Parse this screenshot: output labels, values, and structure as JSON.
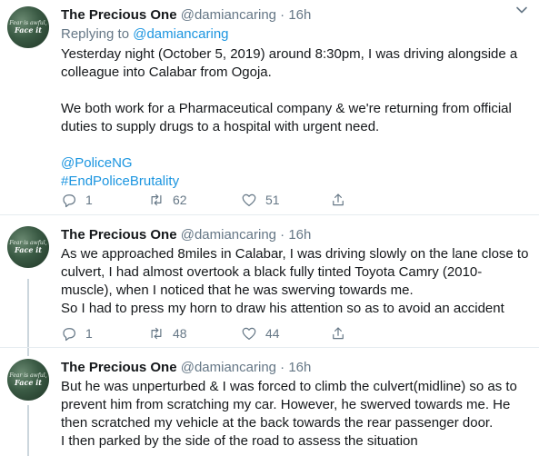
{
  "colors": {
    "text": "#14171a",
    "secondary": "#657786",
    "link": "#1b95e0",
    "divider": "#e6ecf0"
  },
  "tweets": [
    {
      "name": "The Precious One",
      "handle": "@damiancaring",
      "dot": "·",
      "time": "16h",
      "avatar_line1": "Fear is awful,",
      "avatar_line2": "Face it",
      "replying_prefix": "Replying to",
      "replying_handle": "@damiancaring",
      "paragraphs": [
        "Yesterday night (October 5, 2019) around 8:30pm, I was driving alongside a colleague into Calabar from Ogoja.",
        "We both work for a Pharmaceutical company & we're returning from official duties to supply drugs to a hospital with urgent need."
      ],
      "links": [
        "@PoliceNG",
        "#EndPoliceBrutality"
      ],
      "replies": "1",
      "retweets": "62",
      "likes": "51"
    },
    {
      "name": "The Precious One",
      "handle": "@damiancaring",
      "dot": "·",
      "time": "16h",
      "avatar_line1": "Fear is awful,",
      "avatar_line2": "Face it",
      "lines": [
        "As we approached 8miles in Calabar, I was driving slowly on the lane close to",
        "culvert, I had almost overtook a black fully tinted Toyota Camry (2010-",
        "muscle), when I noticed that he was swerving towards me.",
        "So I had to press my horn to draw his attention so as to avoid an accident"
      ],
      "replies": "1",
      "retweets": "48",
      "likes": "44"
    },
    {
      "name": "The Precious One",
      "handle": "@damiancaring",
      "dot": "·",
      "time": "16h",
      "avatar_line1": "Fear is awful,",
      "avatar_line2": "Face it",
      "lines": [
        "But he was unperturbed & I was forced to climb the culvert(midline) so as to",
        "prevent him from scratching my car. However, he swerved towards me. He",
        "then scratched my vehicle at the back towards the rear passenger door.",
        "I then parked by the side of the road to assess the situation"
      ]
    }
  ]
}
